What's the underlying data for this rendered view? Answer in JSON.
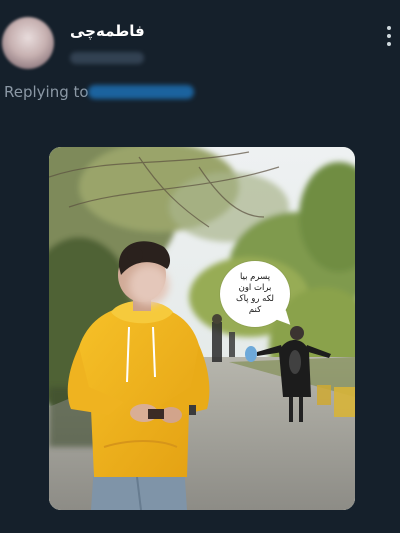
{
  "tweet": {
    "author_name": "فاطمه‌چی",
    "author_handle_hidden": true,
    "replying_label": "Replying to",
    "reply_target_hidden": true,
    "menu_icon": "more-vertical-icon"
  },
  "media": {
    "speech_bubble_text": "پسرم بیا\nبرات اون\nلکه رو پاک\nکنم"
  },
  "colors": {
    "background": "#15202b",
    "muted_text": "#8b98a5",
    "link": "#1d9bf0",
    "hoodie": "#f2b21b"
  }
}
